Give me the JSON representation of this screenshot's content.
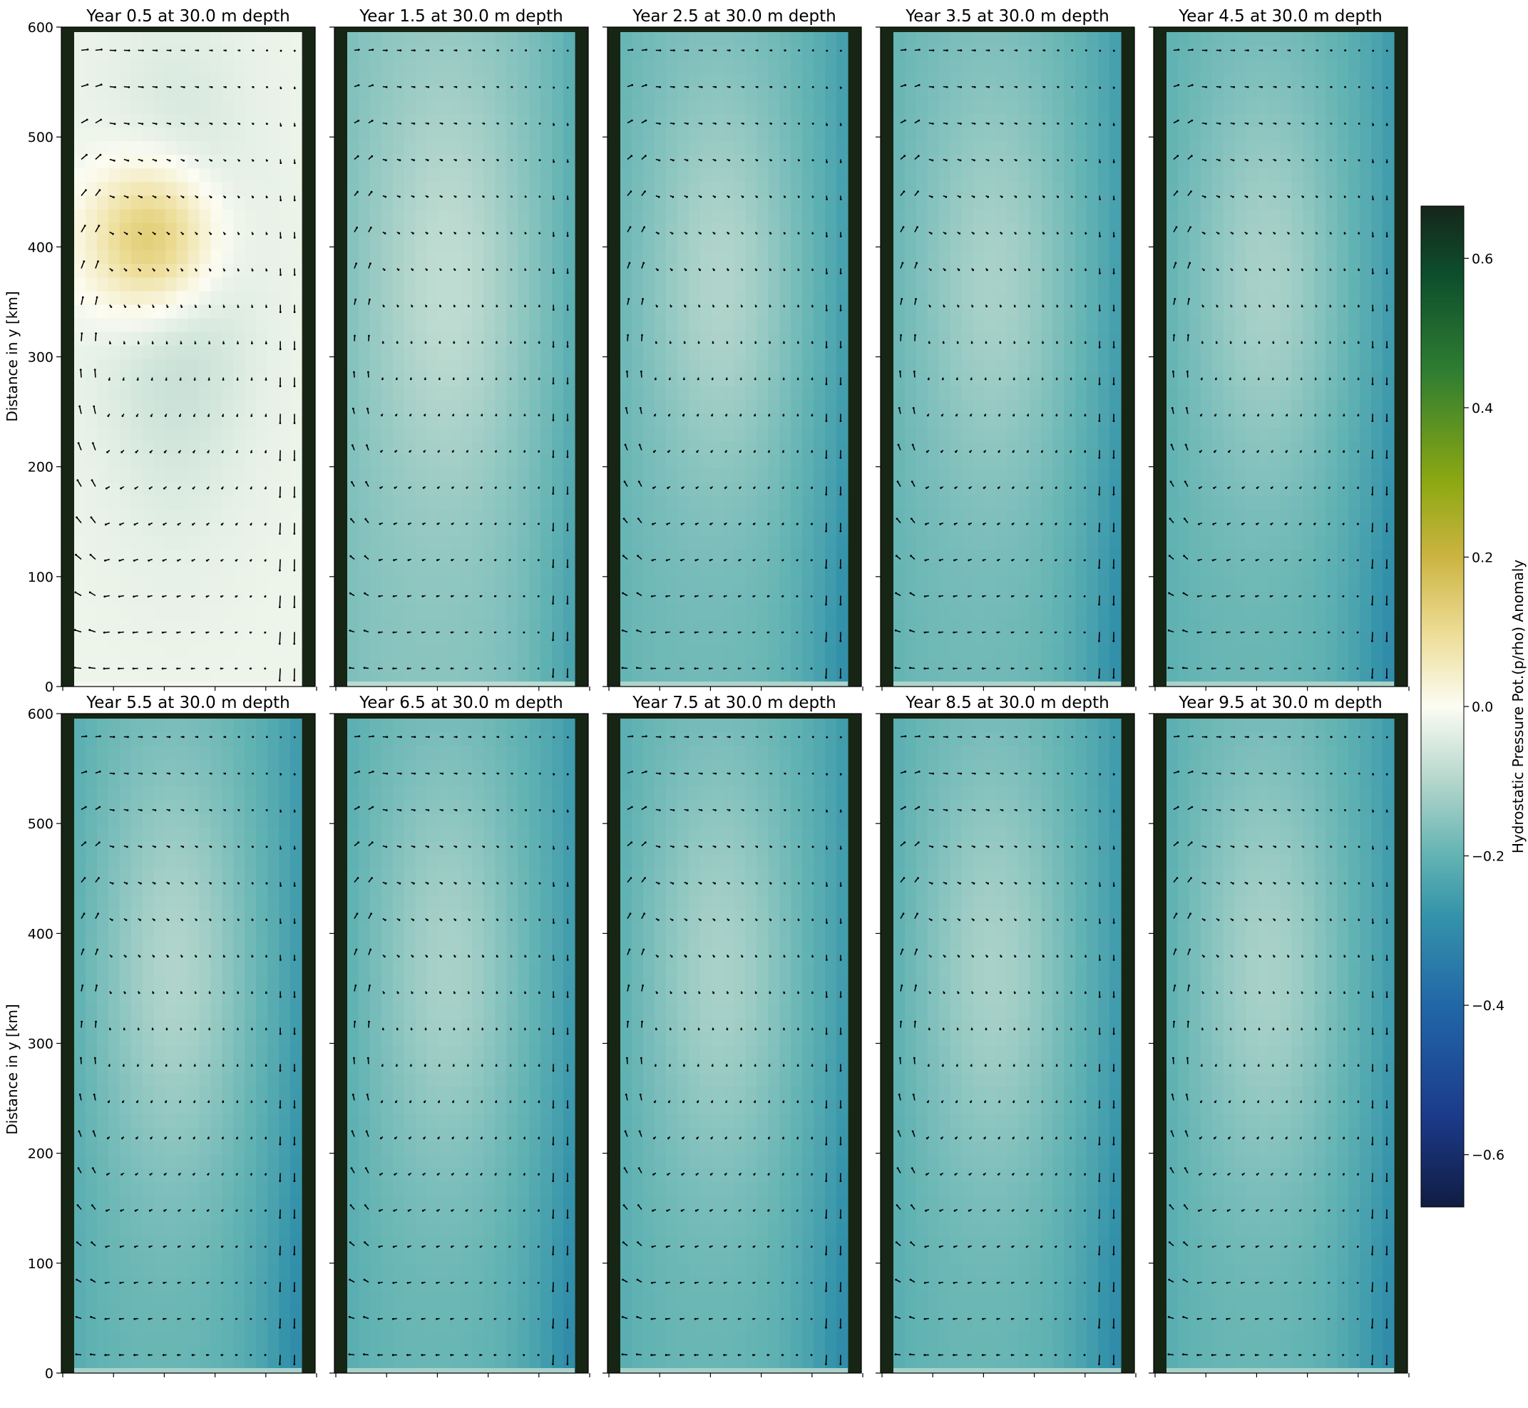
{
  "figure": {
    "ylabel": "Distance in y [km]",
    "colorbar": {
      "label": "Hydrostatic Pressure Pot.(p/rho) Anomaly",
      "vmin": -0.67,
      "vmax": 0.67,
      "ticks": [
        0.6,
        0.4,
        0.2,
        0.0,
        -0.2,
        -0.4,
        -0.6
      ],
      "tick_labels": [
        "0.6",
        "0.4",
        "0.2",
        "0.0",
        "−0.2",
        "−0.4",
        "−0.6"
      ],
      "colors": {
        "-0.67": "#101c42",
        "-0.55": "#1c3a8a",
        "-0.40": "#2167a8",
        "-0.28": "#3493aa",
        "-0.20": "#62b3b3",
        "-0.10": "#b4d6cc",
        "0.00": "#fcfcf2",
        "0.10": "#ecdc94",
        "0.20": "#ccb441",
        "0.30": "#8da812",
        "0.45": "#2e7d32",
        "0.58": "#0d4d2c",
        "0.67": "#16261a"
      }
    },
    "land_color": "#172514",
    "y_ticks": [
      0,
      100,
      200,
      300,
      400,
      500,
      600
    ],
    "ylim": [
      0,
      600
    ]
  },
  "chart_data": [
    {
      "type": "heatmap",
      "title": "Year 0.5 at 30.0 m depth",
      "ylim": [
        0,
        600
      ],
      "ylabel": "Distance in y [km]",
      "field": {
        "background": -0.02,
        "west": -0.02,
        "east": -0.02,
        "center": -0.09,
        "anomaly": {
          "value": 0.12,
          "y": 410,
          "x": 0.35
        }
      },
      "arrow_scale": 1.3
    },
    {
      "type": "heatmap",
      "title": "Year 1.5 at 30.0 m depth",
      "ylim": [
        0,
        600
      ],
      "field": {
        "background": -0.15,
        "west": -0.17,
        "east": -0.22,
        "center": -0.08,
        "south_east": -0.25
      },
      "arrow_scale": 0.9
    },
    {
      "type": "heatmap",
      "title": "Year 2.5 at 30.0 m depth",
      "ylim": [
        0,
        600
      ],
      "field": {
        "background": -0.18,
        "west": -0.2,
        "east": -0.26,
        "center": -0.1,
        "south_east": -0.3
      },
      "arrow_scale": 1.0
    },
    {
      "type": "heatmap",
      "title": "Year 3.5 at 30.0 m depth",
      "ylim": [
        0,
        600
      ],
      "field": {
        "background": -0.18,
        "west": -0.2,
        "east": -0.26,
        "center": -0.11,
        "south_east": -0.3
      },
      "arrow_scale": 1.0
    },
    {
      "type": "heatmap",
      "title": "Year 4.5 at 30.0 m depth",
      "ylim": [
        0,
        600
      ],
      "field": {
        "background": -0.19,
        "west": -0.21,
        "east": -0.27,
        "center": -0.11,
        "south_east": -0.31
      },
      "arrow_scale": 1.0
    },
    {
      "type": "heatmap",
      "title": "Year 5.5 at 30.0 m depth",
      "ylim": [
        0,
        600
      ],
      "ylabel": "Distance in y [km]",
      "field": {
        "background": -0.19,
        "west": -0.22,
        "east": -0.27,
        "center": -0.1,
        "south_east": -0.31
      },
      "arrow_scale": 1.0
    },
    {
      "type": "heatmap",
      "title": "Year 6.5 at 30.0 m depth",
      "ylim": [
        0,
        600
      ],
      "field": {
        "background": -0.19,
        "west": -0.22,
        "east": -0.27,
        "center": -0.11,
        "south_east": -0.31
      },
      "arrow_scale": 1.0
    },
    {
      "type": "heatmap",
      "title": "Year 7.5 at 30.0 m depth",
      "ylim": [
        0,
        600
      ],
      "field": {
        "background": -0.19,
        "west": -0.22,
        "east": -0.27,
        "center": -0.11,
        "south_east": -0.31
      },
      "arrow_scale": 1.0
    },
    {
      "type": "heatmap",
      "title": "Year 8.5 at 30.0 m depth",
      "ylim": [
        0,
        600
      ],
      "field": {
        "background": -0.19,
        "west": -0.22,
        "east": -0.27,
        "center": -0.11,
        "south_east": -0.31
      },
      "arrow_scale": 1.0
    },
    {
      "type": "heatmap",
      "title": "Year 9.5 at 30.0 m depth",
      "ylim": [
        0,
        600
      ],
      "field": {
        "background": -0.19,
        "west": -0.22,
        "east": -0.27,
        "center": -0.11,
        "south_east": -0.31
      },
      "arrow_scale": 1.0
    }
  ]
}
